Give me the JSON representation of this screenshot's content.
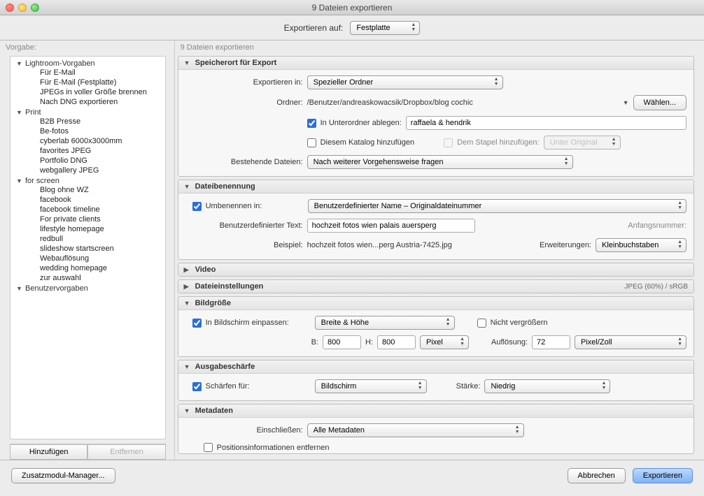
{
  "window": {
    "title": "9 Dateien exportieren"
  },
  "toprow": {
    "label": "Exportieren auf:",
    "dest": "Festplatte"
  },
  "left": {
    "heading": "Vorgabe:",
    "groups": [
      {
        "label": "Lightroom-Vorgaben",
        "items": [
          "Für E-Mail",
          "Für E-Mail (Festplatte)",
          "JPEGs in voller Größe brennen",
          "Nach DNG exportieren"
        ]
      },
      {
        "label": "Print",
        "items": [
          "B2B Presse",
          "Be-fotos",
          "cyberlab 6000x3000mm",
          "favorites JPEG",
          "Portfolio DNG",
          "webgallery JPEG"
        ]
      },
      {
        "label": "for screen",
        "items": [
          "Blog ohne WZ",
          "facebook",
          "facebook timeline",
          "For private clients",
          "lifestyle homepage",
          "redbull",
          "slideshow startscreen",
          "Webauflösung",
          "wedding homepage",
          "zur auswahl"
        ]
      },
      {
        "label": "Benutzervorgaben",
        "items": []
      }
    ],
    "add": "Hinzufügen",
    "remove": "Entfernen"
  },
  "right_heading": "9 Dateien exportieren",
  "location": {
    "title": "Speicherort für Export",
    "exportin_label": "Exportieren in:",
    "exportin_value": "Spezieller Ordner",
    "folder_label": "Ordner:",
    "folder_path": "/Benutzer/andreaskowacsik/Dropbox/blog cochic",
    "choose": "Wählen...",
    "subfolder_label": "In Unterordner ablegen:",
    "subfolder_value": "raffaela & hendrik",
    "addcat_label": "Diesem Katalog hinzufügen",
    "addstack_label": "Dem Stapel hinzufügen:",
    "stackpos": "Unter Original",
    "existing_label": "Bestehende Dateien:",
    "existing_value": "Nach weiterer Vorgehensweise fragen"
  },
  "naming": {
    "title": "Dateibenennung",
    "rename_label": "Umbenennen in:",
    "template": "Benutzerdefinierter Name – Originaldateinummer",
    "custom_label": "Benutzerdefinierter Text:",
    "custom_value": "hochzeit fotos wien palais auersperg",
    "startnum_label": "Anfangsnummer:",
    "example_label": "Beispiel:",
    "example_value": "hochzeit fotos wien...perg Austria-7425.jpg",
    "ext_label": "Erweiterungen:",
    "ext_value": "Kleinbuchstaben"
  },
  "video": {
    "title": "Video"
  },
  "filesettings": {
    "title": "Dateieinstellungen",
    "summary": "JPEG (60%) / sRGB"
  },
  "sizing": {
    "title": "Bildgröße",
    "fit_label": "In Bildschirm einpassen:",
    "fit_mode": "Breite & Höhe",
    "noenlarge": "Nicht vergrößern",
    "w_label": "B:",
    "w": "800",
    "h_label": "H:",
    "h": "800",
    "unit": "Pixel",
    "res_label": "Auflösung:",
    "res": "72",
    "res_unit": "Pixel/Zoll"
  },
  "sharpen": {
    "title": "Ausgabeschärfe",
    "for_label": "Schärfen für:",
    "for_value": "Bildschirm",
    "amount_label": "Stärke:",
    "amount_value": "Niedrig"
  },
  "metadata": {
    "title": "Metadaten",
    "include_label": "Einschließen:",
    "include_value": "Alle Metadaten",
    "removegeo": "Positionsinformationen entfernen"
  },
  "footer": {
    "plugin": "Zusatzmodul-Manager...",
    "cancel": "Abbrechen",
    "export": "Exportieren"
  }
}
